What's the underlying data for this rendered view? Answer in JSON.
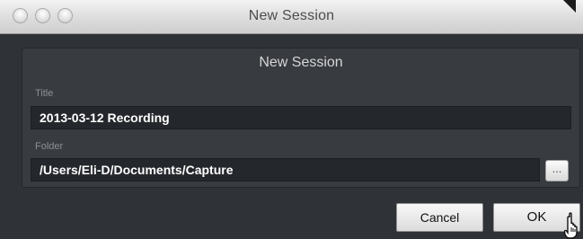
{
  "window": {
    "title": "New Session"
  },
  "dialog": {
    "heading": "New Session",
    "title_label": "Title",
    "title_value": "2013-03-12 Recording",
    "folder_label": "Folder",
    "folder_value": "/Users/Eli-D/Documents/Capture",
    "browse_label": "...",
    "cancel_label": "Cancel",
    "ok_label": "OK"
  },
  "icons": {
    "window_controls": [
      "close-icon",
      "minimize-icon",
      "zoom-icon"
    ],
    "cursor": "hand-pointer-icon"
  }
}
